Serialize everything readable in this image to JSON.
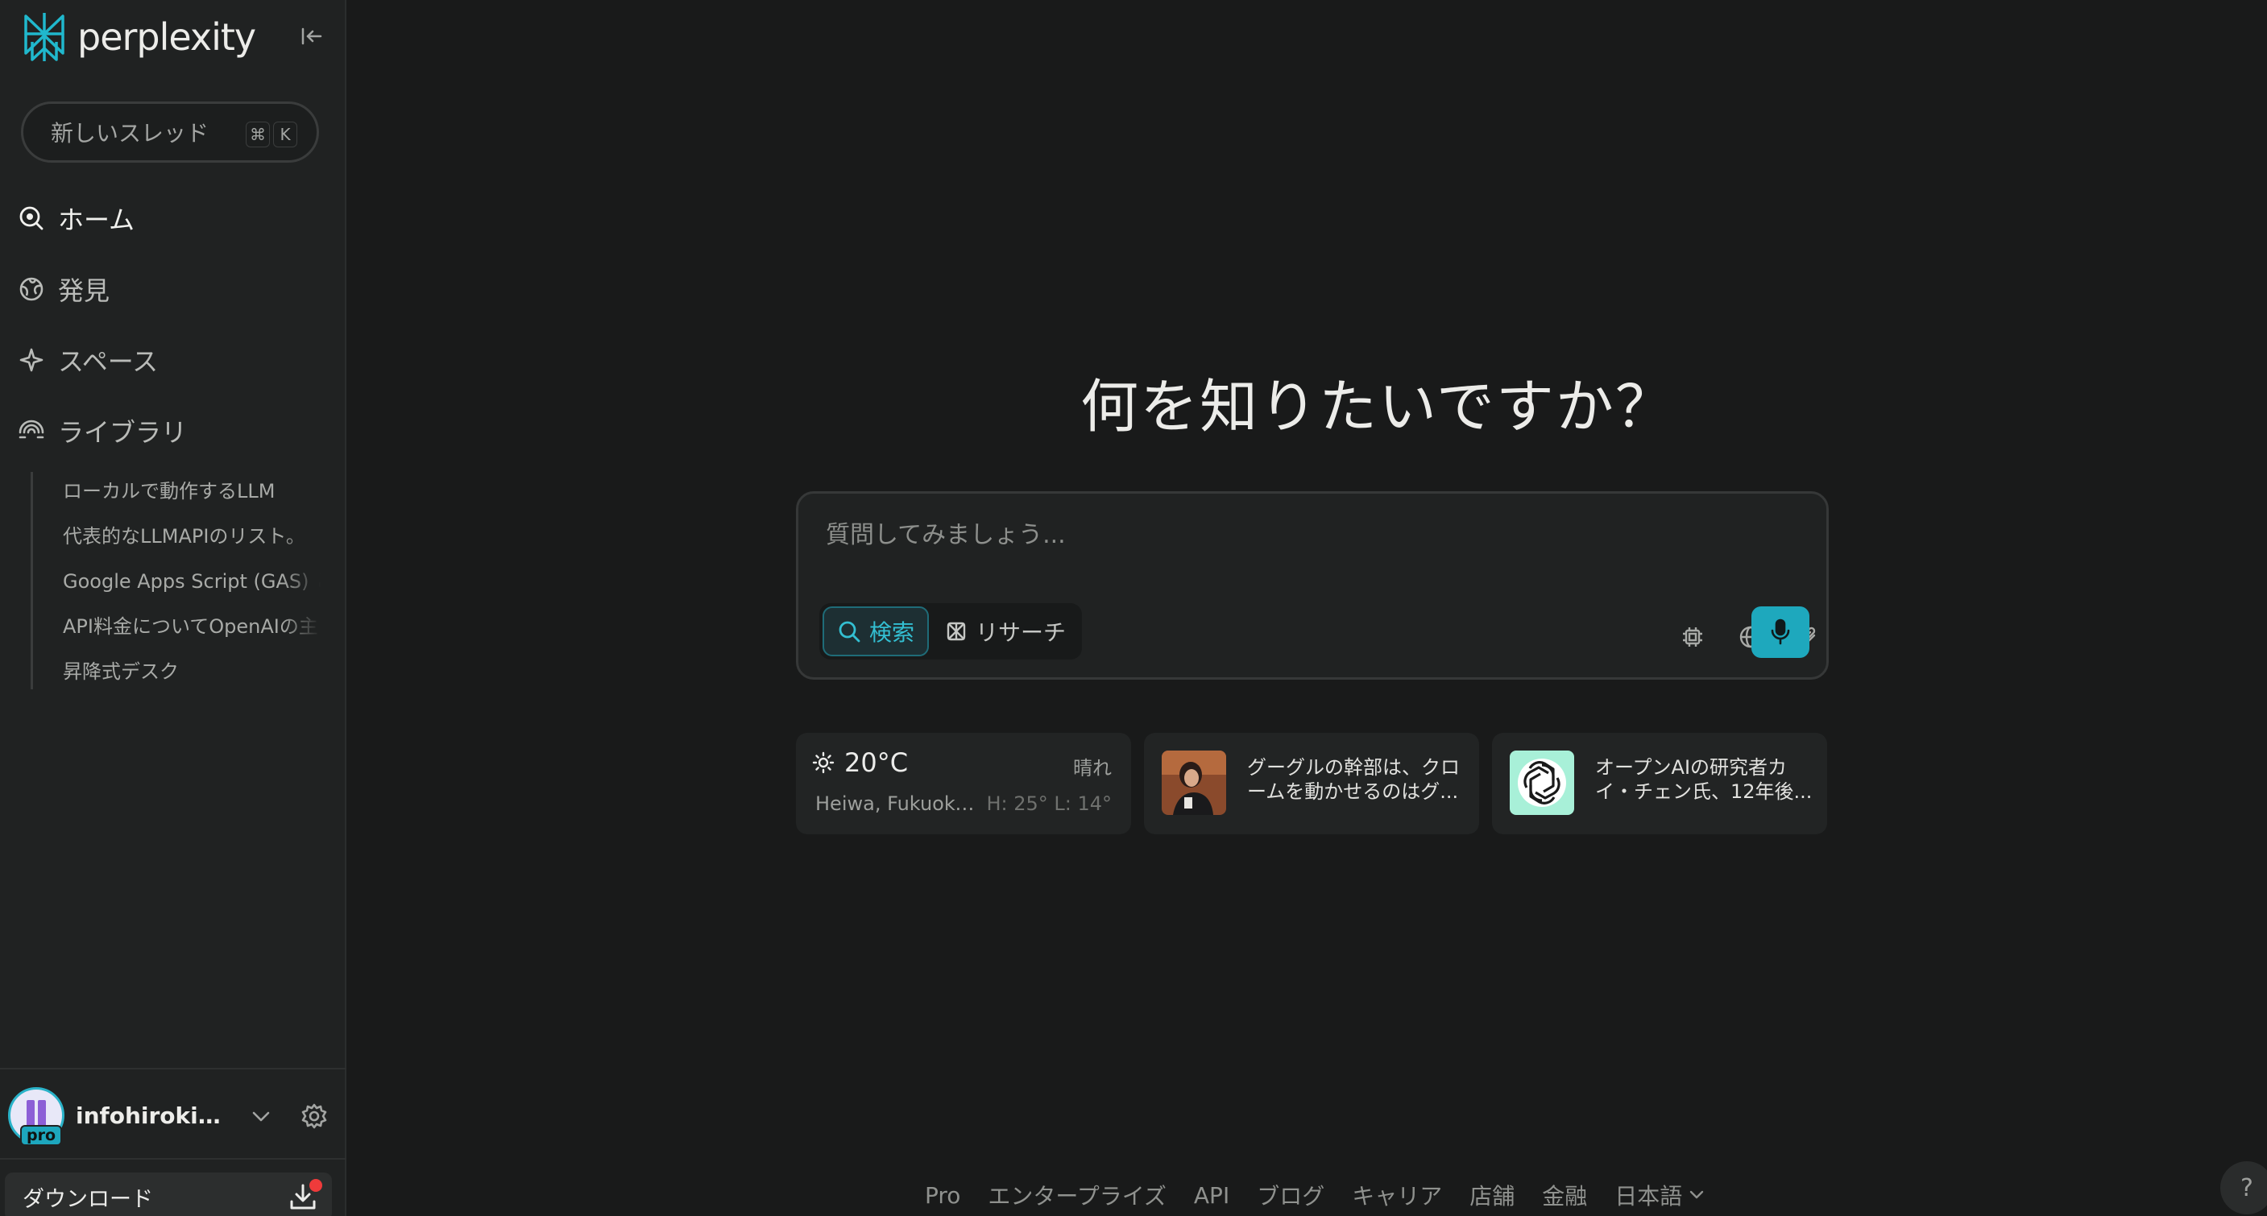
{
  "app": {
    "brand": "perplexity",
    "accent_color": "#1ea8bd"
  },
  "sidebar": {
    "new_thread": {
      "label": "新しいスレッド",
      "shortcut": [
        "⌘",
        "K"
      ]
    },
    "nav": [
      {
        "label": "ホーム",
        "icon": "home-search-icon",
        "active": true
      },
      {
        "label": "発見",
        "icon": "globe-discover-icon",
        "active": false
      },
      {
        "label": "スペース",
        "icon": "spaces-sparkle-icon",
        "active": false
      },
      {
        "label": "ライブラリ",
        "icon": "library-icon",
        "active": false
      }
    ],
    "library_items": [
      "ローカルで動作するLLM",
      "代表的なLLMAPIのリスト。",
      "Google Apps Script (GAS) と",
      "API料金についてOpenAIの主",
      "昇降式デスク"
    ],
    "user": {
      "name": "infohirokitak...",
      "badge": "pro"
    },
    "download": {
      "label": "ダウンロード"
    }
  },
  "main": {
    "headline": "何を知りたいですか？",
    "search": {
      "placeholder": "質問してみましょう...",
      "modes": [
        {
          "label": "検索",
          "icon": "search-icon",
          "active": true
        },
        {
          "label": "リサーチ",
          "icon": "research-icon",
          "active": false
        }
      ]
    },
    "cards": {
      "weather": {
        "temp": "20°C",
        "condition": "晴れ",
        "location": "Heiwa, Fukuoka-...",
        "high_low": "H: 25° L: 14°"
      },
      "news": [
        {
          "text": "グーグルの幹部は、クロームを動かせるのはグ..."
        },
        {
          "text": "オープンAIの研究者カイ・チェン氏、12年後..."
        }
      ]
    }
  },
  "footer": {
    "links": [
      "Pro",
      "エンタープライズ",
      "API",
      "ブログ",
      "キャリア",
      "店舗",
      "金融"
    ],
    "language": "日本語"
  },
  "help": {
    "label": "?"
  }
}
